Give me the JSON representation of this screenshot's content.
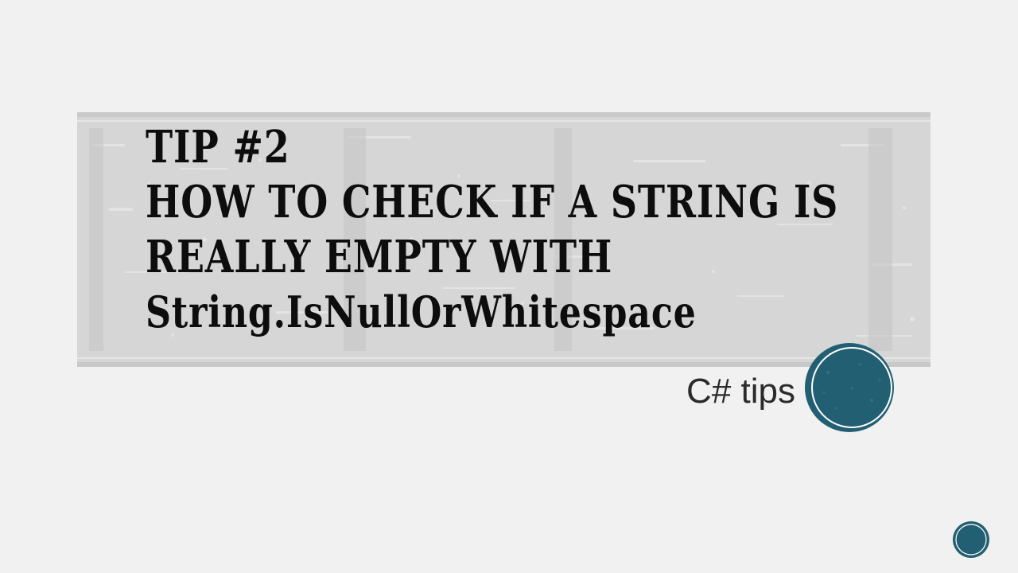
{
  "slide": {
    "title_lines": [
      "Tip #2",
      "How to check if a string is",
      "really empty with",
      "String.IsNullOrWhitespace"
    ],
    "subtitle": "C# tips"
  },
  "theme": {
    "background": "#f1f1f1",
    "band": "#d8d8d8",
    "accent": "#235f73",
    "title_color": "#0d0d0d",
    "subtitle_color": "#2b2b2b"
  },
  "icons": {
    "badge": "circle-badge-icon",
    "slide_number": "slide-number-icon"
  }
}
